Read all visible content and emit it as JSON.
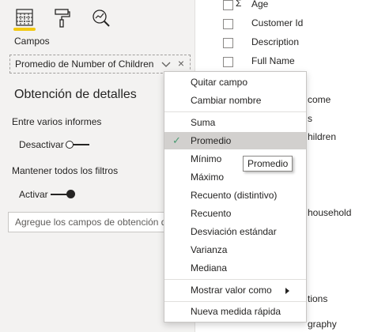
{
  "visualizations": {
    "tabs": [
      {
        "name": "fields-tab",
        "icon": "fields-well-icon",
        "active": true
      },
      {
        "name": "format-tab",
        "icon": "paint-roller-icon",
        "active": false
      },
      {
        "name": "analytics-tab",
        "icon": "analytics-magnifier-icon",
        "active": false
      }
    ],
    "section_label": "Campos",
    "field_well_value": "Promedio de Number of Children",
    "drillthrough": {
      "title": "Obtención de detalles",
      "cross_report_label": "Entre varios informes",
      "cross_report_toggle": "Desactivar",
      "keep_filters_label": "Mantener todos los filtros",
      "keep_filters_toggle": "Activar",
      "drop_placeholder": "Agregue los campos de obtención de detalles aquí"
    }
  },
  "fields_list": {
    "items": [
      {
        "sigma": "Σ",
        "name": "Age"
      },
      {
        "sigma": "",
        "name": "Customer Id"
      },
      {
        "sigma": "",
        "name": "Description"
      },
      {
        "sigma": "",
        "name": "Full Name"
      }
    ],
    "peek_texts": [
      "come",
      "s",
      "hildren",
      "household",
      "tions",
      "graphy"
    ]
  },
  "context_menu": {
    "items": [
      {
        "label": "Quitar campo"
      },
      {
        "label": "Cambiar nombre"
      },
      {
        "label": "Suma"
      },
      {
        "label": "Promedio",
        "selected": true
      },
      {
        "label": "Mínimo"
      },
      {
        "label": "Máximo"
      },
      {
        "label": "Recuento (distintivo)"
      },
      {
        "label": "Recuento"
      },
      {
        "label": "Desviación estándar"
      },
      {
        "label": "Varianza"
      },
      {
        "label": "Mediana"
      },
      {
        "label": "Mostrar valor como",
        "submenu": true
      },
      {
        "label": "Nueva medida rápida"
      }
    ],
    "check_glyph": "✓"
  },
  "tooltip": "Promedio",
  "colors": {
    "accent": "#f2c811",
    "check": "#4a9b73",
    "selected_bg": "#d2d0ce"
  }
}
